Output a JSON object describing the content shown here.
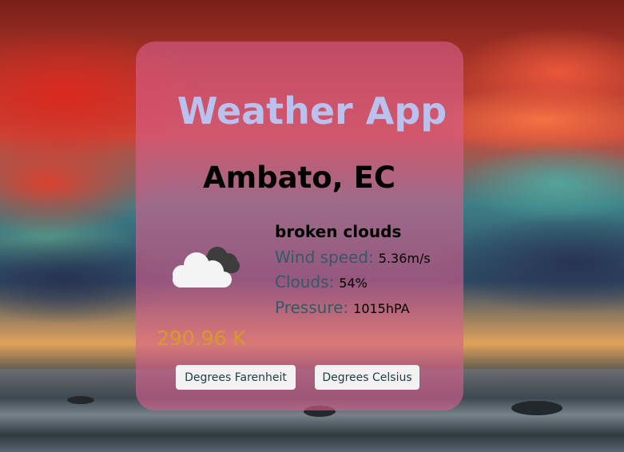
{
  "app": {
    "title": "Weather App"
  },
  "location": {
    "city": "Ambato, EC"
  },
  "weather": {
    "icon": "broken-clouds-icon",
    "description": "broken clouds",
    "wind_label": "Wind speed:",
    "wind_value": "5.36m/s",
    "clouds_label": "Clouds:",
    "clouds_value": "54%",
    "pressure_label": "Pressure:",
    "pressure_value": "1015hPA",
    "temperature": "290.96 K"
  },
  "buttons": {
    "fahrenheit_label": "Degrees Farenheit",
    "celsius_label": "Degrees Celsius"
  },
  "colors": {
    "card": "#d75f8c",
    "title": "#b9c2ee",
    "label": "#2f5c66",
    "temperature": "#d99a25"
  }
}
